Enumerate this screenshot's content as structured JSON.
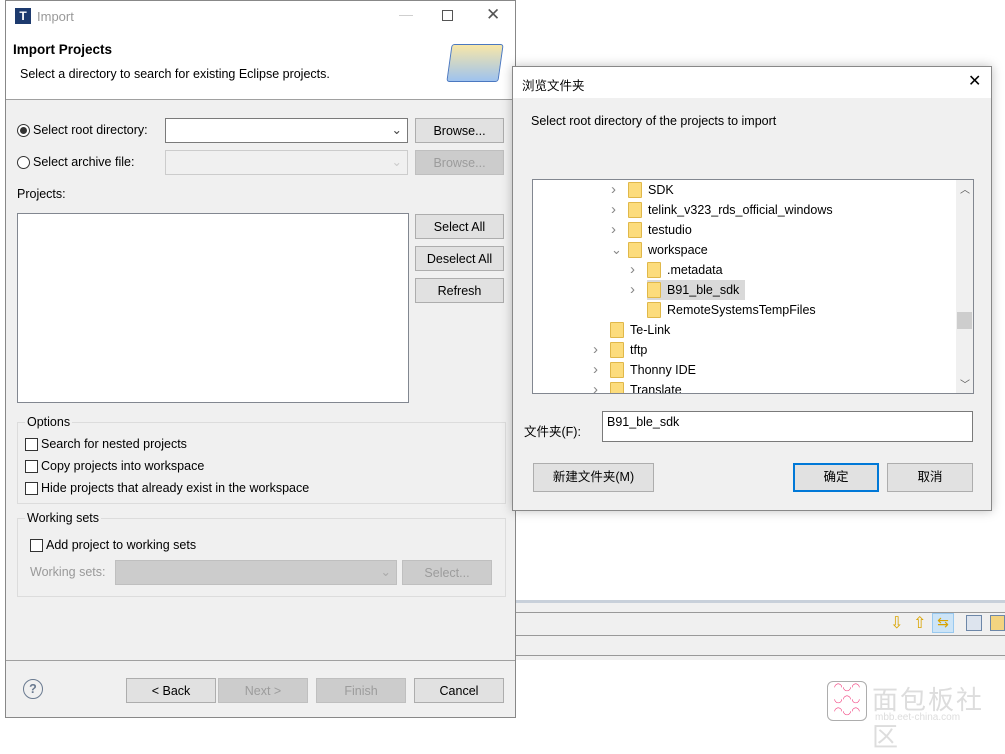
{
  "import_dialog": {
    "title": "Import",
    "header_title": "Import Projects",
    "header_desc": "Select a directory to search for existing Eclipse projects.",
    "root_dir_label": "Select root directory:",
    "root_dir_value": "",
    "archive_label": "Select archive file:",
    "browse_label": "Browse...",
    "projects_label": "Projects:",
    "select_all": "Select All",
    "deselect_all": "Deselect All",
    "refresh": "Refresh",
    "options_title": "Options",
    "options": [
      "Search for nested projects",
      "Copy projects into workspace",
      "Hide projects that already exist in the workspace"
    ],
    "working_sets_title": "Working sets",
    "add_working_sets": "Add project to working sets",
    "working_sets_label": "Working sets:",
    "select_label": "Select...",
    "back": "< Back",
    "next": "Next >",
    "finish": "Finish",
    "cancel": "Cancel"
  },
  "browse_dialog": {
    "title": "浏览文件夹",
    "prompt": "Select root directory of the projects to import",
    "tree": [
      {
        "label": "SDK",
        "level": 1,
        "chevron": "right"
      },
      {
        "label": "telink_v323_rds_official_windows",
        "level": 1,
        "chevron": "right"
      },
      {
        "label": "testudio",
        "level": 1,
        "chevron": "right"
      },
      {
        "label": "workspace",
        "level": 1,
        "chevron": "down"
      },
      {
        "label": ".metadata",
        "level": 2,
        "chevron": "right"
      },
      {
        "label": "B91_ble_sdk",
        "level": 2,
        "chevron": "right",
        "selected": true
      },
      {
        "label": "RemoteSystemsTempFiles",
        "level": 2,
        "chevron": "none"
      },
      {
        "label": "Te-Link",
        "level": 0,
        "chevron": "none"
      },
      {
        "label": "tftp",
        "level": 0,
        "chevron": "right"
      },
      {
        "label": "Thonny IDE",
        "level": 0,
        "chevron": "right"
      },
      {
        "label": "Translate",
        "level": 0,
        "chevron": "right"
      }
    ],
    "folder_label": "文件夹(F):",
    "folder_value": "B91_ble_sdk",
    "new_folder": "新建文件夹(M)",
    "ok": "确定",
    "cancel": "取消"
  },
  "watermark": {
    "text": "面包板社区",
    "sub": "mbb.eet-china.com"
  }
}
